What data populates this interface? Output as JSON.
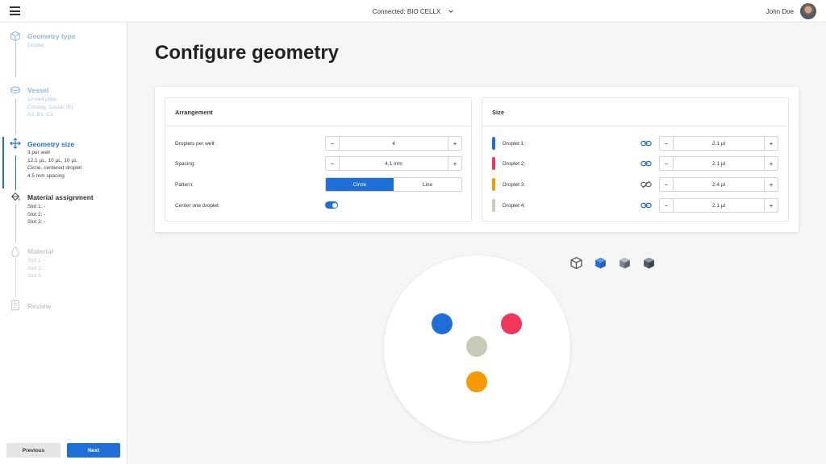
{
  "topbar": {
    "connection_text": "Connected: BIO CELLX",
    "user_name": "John Doe"
  },
  "sidebar": {
    "steps": [
      {
        "title": "Geometry type",
        "lines": [
          "Droplet"
        ],
        "state": "done",
        "icon": "cube-icon"
      },
      {
        "title": "Vessel",
        "lines": [
          "12 well plate",
          "Corning, Costar (R)",
          "A3, B3, C3"
        ],
        "state": "done",
        "icon": "dish-icon"
      },
      {
        "title": "Geometry size",
        "lines": [
          "3 per well",
          "12.1 µL, 10 µL, 10 µL",
          "Circle, centered droplet",
          "4.5 mm spacing"
        ],
        "state": "active",
        "icon": "move-arrows-icon"
      },
      {
        "title": "Material assignment",
        "lines": [
          "Slot 1: -",
          "Slot 2: -",
          "Slot 3: -"
        ],
        "state": "next",
        "icon": "paint-bucket-icon"
      },
      {
        "title": "Material",
        "lines": [
          "Slot 1: -",
          "Slot 2: -",
          "Slot 3: -"
        ],
        "state": "future",
        "icon": "drop-icon"
      },
      {
        "title": "Review",
        "lines": [],
        "state": "future",
        "icon": "document-icon"
      }
    ],
    "previous_label": "Previous",
    "next_label": "Next"
  },
  "main": {
    "page_title": "Configure geometry"
  },
  "arrangement": {
    "header": "Arrangement",
    "droplets_label": "Droplets per well:",
    "droplets_value": "4",
    "spacing_label": "Spacing:",
    "spacing_value": "4.1 mm",
    "pattern_label": "Pattern:",
    "pattern_options": [
      "Circle",
      "Line"
    ],
    "pattern_selected": "Circle",
    "center_label": "Center one droplet:",
    "center_on": true
  },
  "size": {
    "header": "Size",
    "droplets": [
      {
        "label": "Droplet 1:",
        "value": "2.1 µl",
        "color": "#1f6fd9",
        "linked": true
      },
      {
        "label": "Droplet 2:",
        "value": "2.1 µl",
        "color": "#f0365b",
        "linked": true
      },
      {
        "label": "Droplet 3:",
        "value": "2.4 µl",
        "color": "#f59a00",
        "linked": false
      },
      {
        "label": "Droplet 4:",
        "value": "2.1 µl",
        "color": "#c8cbb5",
        "linked": true
      }
    ]
  },
  "stepper": {
    "minus": "−",
    "plus": "+"
  },
  "view_icons": [
    "cube-outline-icon",
    "cube-blue-icon",
    "cube-gray-icon",
    "cube-dark-icon"
  ],
  "colors": {
    "accent": "#1f6fd9",
    "droplet1": "#1f6fd9",
    "droplet2": "#f0365b",
    "droplet3": "#f59a00",
    "droplet4": "#c8cbb5"
  }
}
